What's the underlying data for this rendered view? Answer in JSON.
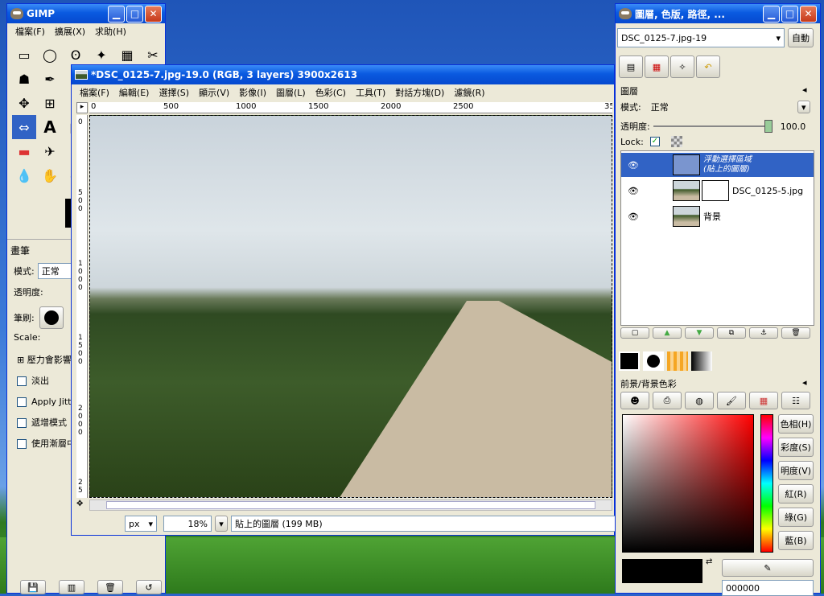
{
  "toolbox": {
    "title": "GIMP",
    "menu": [
      "檔案(F)",
      "擴展(X)",
      "求助(H)"
    ],
    "section_title": "畫筆",
    "mode_label": "模式:",
    "mode_value": "正常",
    "opacity_label": "透明度:",
    "brush_label": "筆刷:",
    "scale_label": "Scale:",
    "options": [
      "壓力會影響",
      "淡出",
      "Apply Jitter",
      "遞增模式",
      "使用漸層中"
    ]
  },
  "image_window": {
    "title": "*DSC_0125-7.jpg-19.0 (RGB, 3 layers) 3900x2613",
    "menu": [
      "檔案(F)",
      "編輯(E)",
      "選擇(S)",
      "顯示(V)",
      "影像(I)",
      "圖層(L)",
      "色彩(C)",
      "工具(T)",
      "對話方塊(D)",
      "濾鏡(R)"
    ],
    "ruler_h": [
      "0",
      "500",
      "1000",
      "1500",
      "2000",
      "2500",
      "35"
    ],
    "ruler_v": [
      "0",
      "5 0 0",
      "1 0 0 0",
      "1 5 0 0",
      "2 0 0 0",
      "2 5"
    ],
    "unit": "px",
    "zoom": "18%",
    "status": "貼上的圖層 (199 MB)"
  },
  "dock": {
    "title": "圖層, 色版, 路徑, ...",
    "image_select": "DSC_0125-7.jpg-19",
    "auto_button": "自動",
    "layers_title": "圖層",
    "mode_label": "模式:",
    "mode_value": "正常",
    "opacity_label": "透明度:",
    "opacity_value": "100.0",
    "lock_label": "Lock:",
    "layers": [
      {
        "name": "浮動選擇區域\n(貼上的圖層)",
        "selected": true
      },
      {
        "name": "DSC_0125-5.jpg",
        "selected": false
      },
      {
        "name": "背景",
        "selected": false
      }
    ],
    "colors_title": "前景/背景色彩",
    "side_buttons": [
      "色相(H)",
      "彩度(S)",
      "明度(V)",
      "紅(R)",
      "綠(G)",
      "藍(B)"
    ],
    "hex_value": "000000",
    "colors": {
      "selection": "#3163c5",
      "title_blue": "#0a5ae0"
    }
  }
}
